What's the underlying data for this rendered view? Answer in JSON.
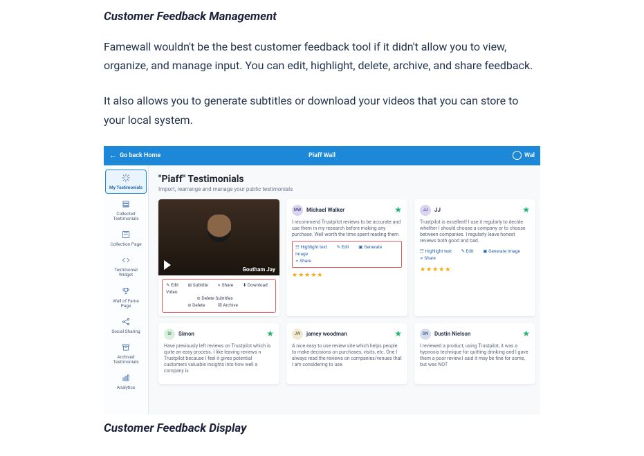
{
  "article": {
    "heading": "Customer Feedback Management",
    "p1": "Famewall wouldn't be the best customer feedback tool if it didn't allow you to view, organize, and manage input. You can edit, highlight, delete, archive, and share feedback.",
    "p2": "It also allows you to generate subtitles or download your videos that you can store to your local system.",
    "caption": "Customer Feedback Display"
  },
  "app": {
    "topbar": {
      "back_label": "Go back Home",
      "wall_title": "Piaff Wall",
      "right_label": "Wal"
    },
    "sidebar": {
      "items": [
        {
          "label": "My Testimonials"
        },
        {
          "label": "Collected Testimonials"
        },
        {
          "label": "Collection Page"
        },
        {
          "label": "Testimonial Widget"
        },
        {
          "label": "Wall of Fame Page"
        },
        {
          "label": "Social Sharing"
        },
        {
          "label": "Archived Testimonials"
        },
        {
          "label": "Analytics"
        }
      ]
    },
    "main": {
      "title": "\"Piaff\" Testimonials",
      "subtitle": "Import, rearrange and manage your public testimonials"
    },
    "video_card": {
      "author": "Goutham Jay",
      "actions": {
        "edit": "Edit",
        "subtitle": "Subtitle",
        "share": "Share",
        "download": "Download Video",
        "delete_subtitles": "Delete Subtitles",
        "delete": "Delete",
        "archive": "Archive"
      }
    },
    "cards": [
      {
        "initials": "MW",
        "name": "Michael Walker",
        "text": "I recommend Trustpilot reviews to be accurate and use them in my research before making any purchase. Well worth the time spent reading them.",
        "actions": {
          "highlight": "Highlight text",
          "edit": "Edit",
          "generate": "Generate Image",
          "share": "Share"
        },
        "rating": "★★★★★"
      },
      {
        "initials": "JJ",
        "name": "JJ",
        "text": "Trustpilot is excellent! I use it regularly to decide whether I should choose a company or to choose between companies. I regularly leave honest reviews both good and bad.",
        "actions": {
          "highlight": "Highlight text",
          "edit": "Edit",
          "generate": "Generate Image",
          "share": "Share"
        },
        "rating": "★★★★★"
      },
      {
        "initials": "SI",
        "name": "Simon",
        "text": "Have previously left reviews on Trustpilot which is quite an easy process. I like leaving reviews n Trustpilot because I feel it gives potential customers valuable insights into how well a company is"
      },
      {
        "initials": "JW",
        "name": "jamey woodman",
        "text": "A nice easy to use review site which helps people to make decisions on purchases, visits, etc. One I always read the reviews on companies/venues that I am considering to use."
      },
      {
        "initials": "DN",
        "name": "Dustin Nielson",
        "text": "I reviewed a product, using Trustpilot, it was a hypnosis technique for quitting drinking and I gave them a poor review.I said it may be fine for some, but was NOT"
      }
    ]
  }
}
